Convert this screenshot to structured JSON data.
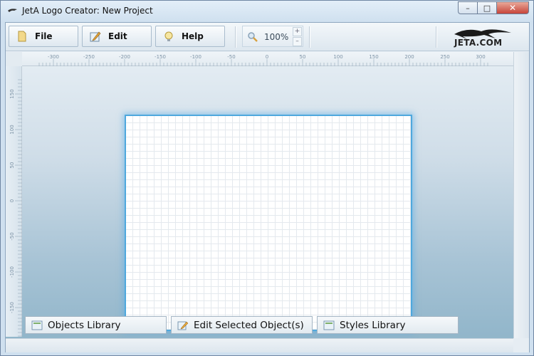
{
  "window": {
    "title": "JetA Logo Creator: New Project",
    "controls": {
      "minimize": "–",
      "maximize": "□",
      "close": "✕"
    }
  },
  "toolbar": {
    "menus": [
      {
        "label": "File",
        "icon": "document-icon"
      },
      {
        "label": "Edit",
        "icon": "edit-pencil-icon"
      },
      {
        "label": "Help",
        "icon": "lightbulb-icon"
      }
    ],
    "zoom": {
      "value": "100%",
      "plus": "+",
      "minus": "–",
      "icon": "magnifier-icon"
    },
    "logo": {
      "text": "JETA.COM",
      "icon": "jet-logo-icon"
    }
  },
  "rulers": {
    "horizontal_ticks": [
      "-300",
      "-250",
      "-200",
      "-150",
      "-100",
      "-50",
      "0",
      "50",
      "100",
      "150",
      "200",
      "250",
      "300"
    ],
    "vertical_ticks": [
      "150",
      "100",
      "50",
      "0",
      "-50",
      "-100",
      "-150"
    ]
  },
  "bottom_tabs": [
    {
      "label": "Objects Library",
      "icon": "objects-library-icon"
    },
    {
      "label": "Edit Selected Object(s)",
      "icon": "edit-object-icon"
    },
    {
      "label": "Styles Library",
      "icon": "styles-library-icon"
    }
  ],
  "colors": {
    "canvas_border": "#4fa8dd",
    "close_button": "#c7453a",
    "workspace_gradient_bottom": "#8db3c8"
  }
}
